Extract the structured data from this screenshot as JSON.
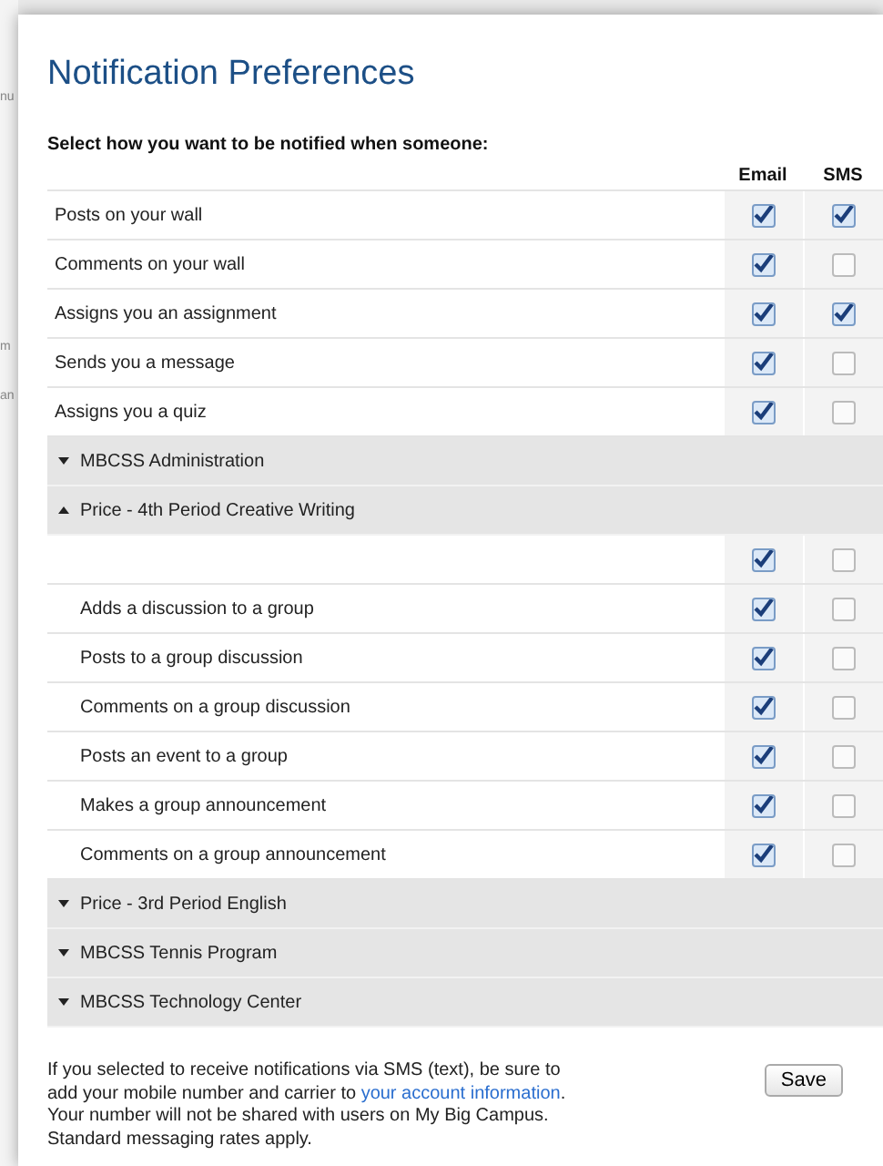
{
  "backdrop": {
    "fragments": [
      "nu",
      "m",
      "an"
    ]
  },
  "dialog": {
    "title": "Notification Preferences",
    "prompt": "Select how you want to be notified when someone:",
    "columns": [
      "Email",
      "SMS"
    ],
    "rows": [
      {
        "label": "Posts on your wall",
        "email": true,
        "sms": true
      },
      {
        "label": "Comments on your wall",
        "email": true,
        "sms": false
      },
      {
        "label": "Assigns you an assignment",
        "email": true,
        "sms": true
      },
      {
        "label": "Sends you a message",
        "email": true,
        "sms": false
      },
      {
        "label": "Assigns you a quiz",
        "email": true,
        "sms": false
      }
    ],
    "groups": [
      {
        "name": "MBCSS Administration",
        "expanded": false
      },
      {
        "name": "Price - 4th Period Creative Writing",
        "expanded": true,
        "rows": [
          {
            "email": true,
            "sms": false
          },
          {
            "label": "Adds a discussion to a group",
            "email": true,
            "sms": false
          },
          {
            "label": "Posts to a group discussion",
            "email": true,
            "sms": false
          },
          {
            "label": "Comments on a group discussion",
            "email": true,
            "sms": false
          },
          {
            "label": "Posts an event to a group",
            "email": true,
            "sms": false
          },
          {
            "label": "Makes a group announcement",
            "email": true,
            "sms": false
          },
          {
            "label": "Comments on a group announcement",
            "email": true,
            "sms": false
          }
        ]
      },
      {
        "name": "Price - 3rd Period English",
        "expanded": false
      },
      {
        "name": "MBCSS Tennis Program",
        "expanded": false
      },
      {
        "name": "MBCSS Technology Center",
        "expanded": false
      }
    ],
    "note": {
      "before": "If you selected to receive notifications via SMS (text), be sure to add your mobile number and carrier to ",
      "link": "your account information",
      "after": ". Your number will not be shared with users on My Big Campus. Standard messaging rates apply."
    },
    "save_button": "Save"
  }
}
